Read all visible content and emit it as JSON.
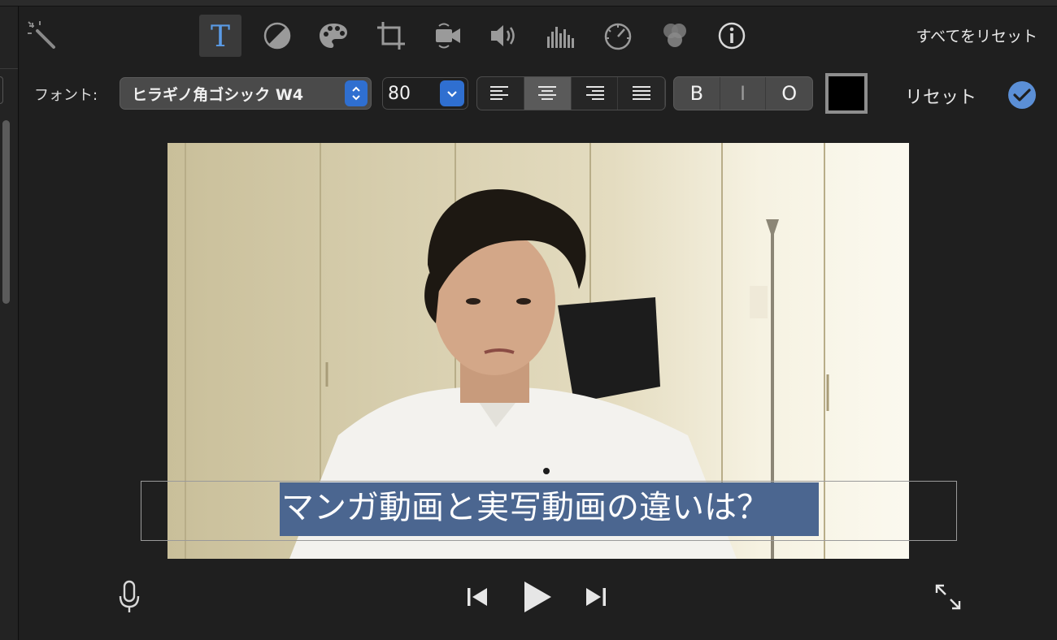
{
  "toolbar": {
    "reset_all_label": "すべてをリセット",
    "tools": [
      {
        "name": "magic-wand",
        "active": false
      },
      {
        "name": "title-text",
        "active": true
      },
      {
        "name": "color-balance",
        "active": false
      },
      {
        "name": "color-correction",
        "active": false
      },
      {
        "name": "crop",
        "active": false
      },
      {
        "name": "stabilization",
        "active": false
      },
      {
        "name": "volume",
        "active": false
      },
      {
        "name": "noise-equalizer",
        "active": false
      },
      {
        "name": "speed",
        "active": false
      },
      {
        "name": "clip-filter",
        "active": false
      },
      {
        "name": "info",
        "active": false
      }
    ],
    "accent_color": "#2f6fd0"
  },
  "text_settings": {
    "font_label": "フォント:",
    "font_value": "ヒラギノ角ゴシック W4",
    "size_value": "80",
    "alignment_selected": "center",
    "style_bold": "B",
    "style_italic": "I",
    "style_outline": "O",
    "text_color": "#000000",
    "reset_label": "リセット"
  },
  "viewer": {
    "caption_text": "マンガ動画と実写動画の違いは？",
    "caption_highlight_color": "#4b6690"
  },
  "playback": {
    "controls": [
      "voiceover-mic",
      "skip-back",
      "play",
      "skip-forward",
      "fullscreen"
    ]
  }
}
